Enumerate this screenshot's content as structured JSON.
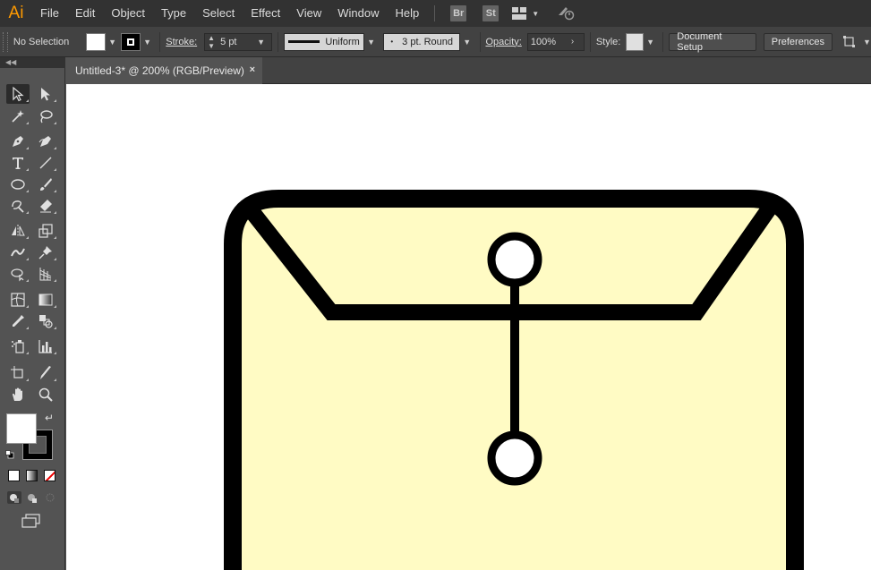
{
  "app": {
    "logo": "Ai"
  },
  "menu": {
    "items": [
      "File",
      "Edit",
      "Object",
      "Type",
      "Select",
      "Effect",
      "View",
      "Window",
      "Help"
    ],
    "bridge_label": "Br",
    "stock_label": "St"
  },
  "control_bar": {
    "selection_status": "No Selection",
    "stroke_label": "Stroke:",
    "stroke_weight": "5 pt",
    "profile_label": "Uniform",
    "brush_label": "3 pt. Round",
    "opacity_label": "Opacity:",
    "opacity_value": "100%",
    "style_label": "Style:",
    "document_setup_label": "Document Setup",
    "preferences_label": "Preferences"
  },
  "document": {
    "tab_title": "Untitled-3* @ 200% (RGB/Preview)",
    "close_glyph": "×"
  },
  "colors": {
    "app_accent": "#ff9a00",
    "envelope_fill": "#fffbc4",
    "envelope_stroke": "#000000",
    "button_fill": "#ffffff",
    "canvas_bg": "#ffffff"
  },
  "tools": [
    "selection-tool",
    "direct-selection-tool",
    "magic-wand-tool",
    "lasso-tool",
    "pen-tool",
    "curvature-tool",
    "type-tool",
    "line-segment-tool",
    "ellipse-tool",
    "paintbrush-tool",
    "shaper-tool",
    "eraser-tool",
    "reflect-tool",
    "scale-tool",
    "width-tool",
    "puppet-warp-tool",
    "shape-builder-tool",
    "perspective-grid-tool",
    "mesh-tool",
    "gradient-tool",
    "eyedropper-tool",
    "blend-tool",
    "symbol-sprayer-tool",
    "column-graph-tool",
    "artboard-tool",
    "slice-tool",
    "hand-tool",
    "zoom-tool"
  ]
}
